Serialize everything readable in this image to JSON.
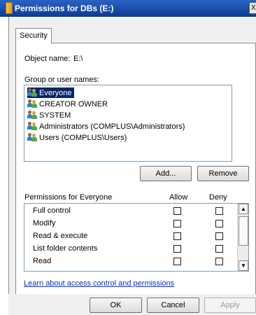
{
  "window": {
    "title": "Permissions for DBs (E:)",
    "close_label": "X"
  },
  "tabs": [
    {
      "label": "Security"
    }
  ],
  "object": {
    "label": "Object name:",
    "value": "E:\\"
  },
  "groups": {
    "label": "Group or user names:",
    "items": [
      {
        "label": "Everyone",
        "selected": true
      },
      {
        "label": "CREATOR OWNER",
        "selected": false
      },
      {
        "label": "SYSTEM",
        "selected": false
      },
      {
        "label": "Administrators (COMPLUS\\Administrators)",
        "selected": false
      },
      {
        "label": "Users (COMPLUS\\Users)",
        "selected": false
      }
    ]
  },
  "buttons": {
    "add": "Add...",
    "remove": "Remove",
    "ok": "OK",
    "cancel": "Cancel",
    "apply": "Apply"
  },
  "permissions": {
    "label": "Permissions for Everyone",
    "allow_header": "Allow",
    "deny_header": "Deny",
    "rows": [
      {
        "name": "Full control",
        "allow": false,
        "deny": false
      },
      {
        "name": "Modify",
        "allow": false,
        "deny": false
      },
      {
        "name": "Read & execute",
        "allow": false,
        "deny": false
      },
      {
        "name": "List folder contents",
        "allow": false,
        "deny": false
      },
      {
        "name": "Read",
        "allow": false,
        "deny": false
      }
    ]
  },
  "link": "Learn about access control and permissions",
  "colors": {
    "titlebar": "#0e3b8f",
    "selection": "#0a246a",
    "link": "#0033cc"
  }
}
